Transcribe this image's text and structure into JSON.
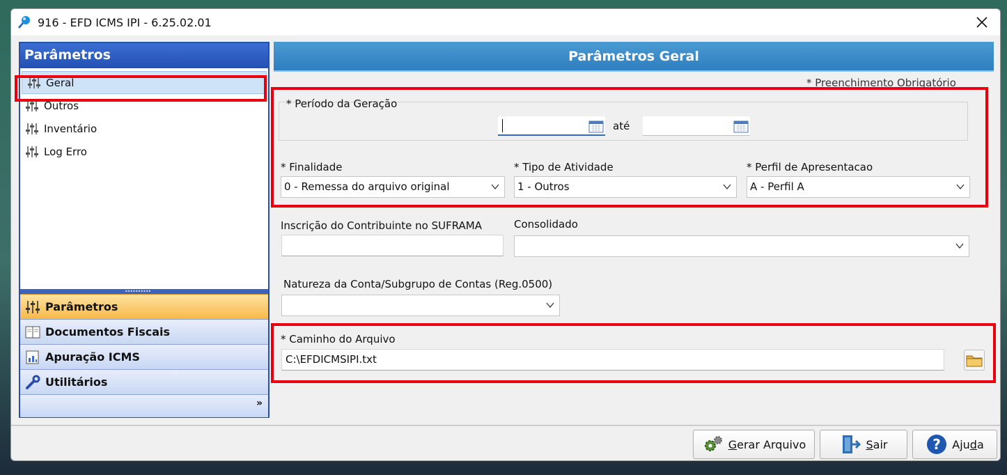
{
  "window": {
    "title": "916 - EFD ICMS IPI - 6.25.02.01"
  },
  "left": {
    "header": "Parâmetros",
    "tree": [
      {
        "label": "Geral",
        "selected": true
      },
      {
        "label": "Outros"
      },
      {
        "label": "Inventário"
      },
      {
        "label": "Log Erro"
      }
    ],
    "nav": [
      {
        "label": "Parâmetros",
        "icon": "sliders-icon",
        "active": true
      },
      {
        "label": "Documentos Fiscais",
        "icon": "book-icon"
      },
      {
        "label": "Apuração ICMS",
        "icon": "report-icon"
      },
      {
        "label": "Utilitários",
        "icon": "wrench-icon"
      }
    ],
    "footer_chevron": "»"
  },
  "main": {
    "header": "Parâmetros Geral",
    "required_note": "* Preenchimento Obrigatório",
    "periodo": {
      "label": "* Período da Geração",
      "start_value": "",
      "end_value": "",
      "separator": "até"
    },
    "finalidade": {
      "label": "* Finalidade",
      "value": "0 - Remessa do arquivo original"
    },
    "tipo_atividade": {
      "label": "* Tipo de Atividade",
      "value": "1 - Outros"
    },
    "perfil": {
      "label": "* Perfil de Apresentacao",
      "value": "A - Perfil A"
    },
    "suframa": {
      "label": "Inscrição do Contribuinte no SUFRAMA",
      "value": ""
    },
    "consolidado": {
      "label": "Consolidado",
      "value": ""
    },
    "natureza": {
      "label": "Natureza da Conta/Subgrupo de Contas (Reg.0500)",
      "value": ""
    },
    "caminho": {
      "label": "* Caminho do Arquivo",
      "value": "C:\\EFDICMSIPI.txt"
    }
  },
  "buttons": {
    "gerar": {
      "first": "G",
      "rest": "erar Arquivo"
    },
    "sair": {
      "first": "S",
      "rest": "air"
    },
    "ajuda": {
      "pre": "Aju",
      "ul": "d",
      "post": "a"
    }
  },
  "colors": {
    "highlight_red": "#e8000e",
    "header_blue": "#2f7ec0",
    "nav_active": "#f8b84a"
  }
}
